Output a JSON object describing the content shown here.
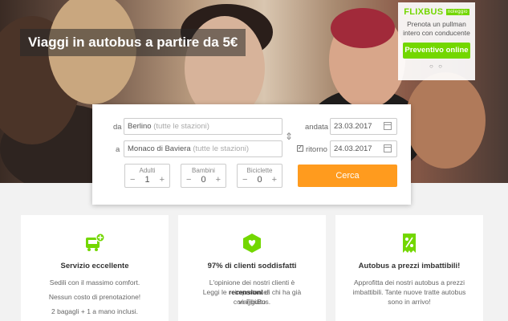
{
  "hero": {
    "title": "Viaggi in autobus a partire da 5€"
  },
  "promo": {
    "brand": "FLIXBUS",
    "brand_sub": "noleggio",
    "text": "Prenota un pullman intero con conducente",
    "button": "Preventivo online",
    "slider_dots": "○ ○"
  },
  "search": {
    "from_label": "da",
    "from_value": "Berlino",
    "from_hint": "(tutte le stazioni)",
    "to_label": "a",
    "to_value": "Monaco di Baviera",
    "to_hint": "(tutte le stazioni)",
    "outbound_label": "andata",
    "outbound_date": "23.03.2017",
    "return_label": "ritorno",
    "return_date": "24.03.2017",
    "return_checked": true,
    "adults_label": "Adulti",
    "adults_value": "1",
    "children_label": "Bambini",
    "children_value": "0",
    "bikes_label": "Biciclette",
    "bikes_value": "0",
    "search_button": "Cerca"
  },
  "features": [
    {
      "icon": "bus-plus-icon",
      "title": "Servizio eccellente",
      "lines": [
        "Sedili con il massimo comfort.",
        "Nessun costo di prenotazione!",
        "2 bagagli + 1 a mano inclusi."
      ]
    },
    {
      "icon": "heart-user-icon",
      "title": "97% di clienti soddisfatti",
      "line1": "L'opinione dei nostri clienti è importante!",
      "line2_pre": "Leggi le",
      "line2_bold": "recensioni",
      "line2_post": "di chi ha già viaggiato",
      "line3": "con FlixBus."
    },
    {
      "icon": "percent-ticket-icon",
      "title": "Autobus a prezzi imbattibili!",
      "lines": [
        "Approfitta dei nostri autobus a prezzi",
        "imbattibili. Tante nuove tratte autobus",
        "sono in arrivo!"
      ]
    }
  ],
  "colors": {
    "brand_green": "#73d700",
    "cta_orange": "#ff9b1e"
  }
}
